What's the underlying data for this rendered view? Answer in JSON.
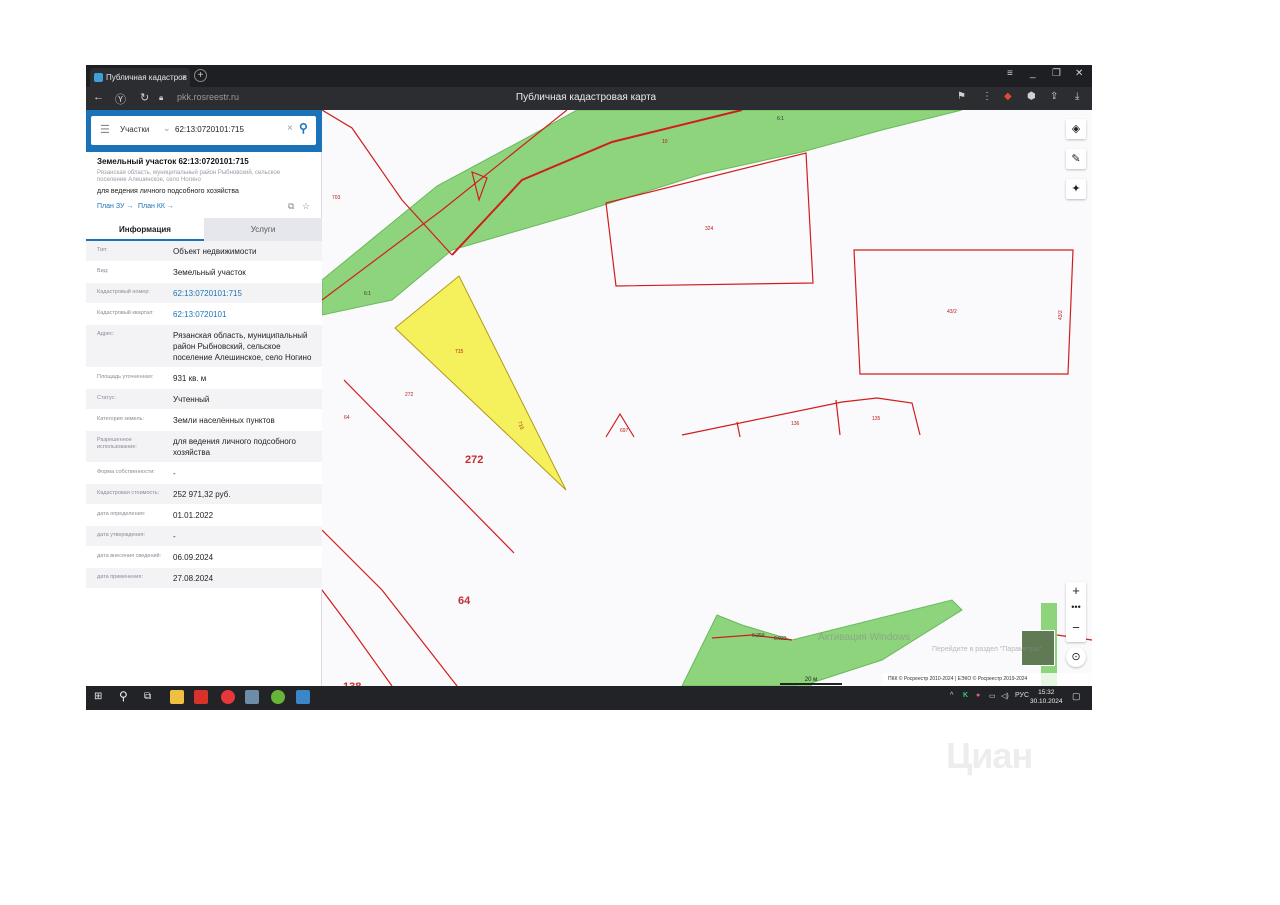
{
  "browser": {
    "tab_title": "Публичная кадастров",
    "url": "pkk.rosreestr.ru",
    "page_title": "Публичная кадастровая карта"
  },
  "search": {
    "type_label": "Участки",
    "value": "62:13:0720101:715"
  },
  "parcel": {
    "title": "Земельный участок 62:13:0720101:715",
    "address_small": "Рязанская область, муниципальный район Рыбновский, сельское поселение Алешинское, село Ногино",
    "purpose": "для ведения личного подсобного хозяйства",
    "link_plan_zu": "План ЗУ →",
    "link_plan_kk": "План КК →"
  },
  "tabs": {
    "info": "Информация",
    "services": "Услуги"
  },
  "info_rows": [
    {
      "key": "Тип:",
      "value": "Объект недвижимости"
    },
    {
      "key": "Вид:",
      "value": "Земельный участок"
    },
    {
      "key": "Кадастровый номер:",
      "value": "62:13:0720101:715"
    },
    {
      "key": "Кадастровый квартал:",
      "value": "62:13:0720101"
    },
    {
      "key": "Адрес:",
      "value": "Рязанская область, муниципальный район Рыбновский, сельское поселение Алешинское, село Ногино"
    },
    {
      "key": "Площадь уточненная:",
      "value": "931 кв. м"
    },
    {
      "key": "Статус:",
      "value": "Учтенный"
    },
    {
      "key": "Категория земель:",
      "value": "Земли населённых пунктов"
    },
    {
      "key": "Разрешенное использование:",
      "value": "для ведения личного подсобного хозяйства"
    },
    {
      "key": "Форма собственности:",
      "value": "-"
    },
    {
      "key": "Кадастровая стоимость:",
      "value": "252 971,32 руб."
    },
    {
      "key": "дата определения:",
      "value": "01.01.2022"
    },
    {
      "key": "дата утверждения:",
      "value": "-"
    },
    {
      "key": "дата внесения сведений:",
      "value": "06.09.2024"
    },
    {
      "key": "дата применения:",
      "value": "27.08.2024"
    }
  ],
  "map_labels": {
    "l703": "703",
    "l61a": "6:1",
    "l61b": "6:1",
    "l10": "10",
    "l324": "324",
    "l432a": "43/2",
    "l432b": "43/2",
    "l715a": "715",
    "l715b": "715",
    "l272s": "272",
    "l272b": "272",
    "l64s": "64",
    "l64b": "64",
    "l697": "697",
    "l136": "136",
    "l135": "135",
    "l138": "138",
    "l6259": "6:259",
    "l6923": "6:923"
  },
  "map": {
    "scale": "20 м",
    "watermark1": "Активация Windows",
    "watermark2": "Перейдите в раздел \"Параметры\"",
    "copyright": "ПКК © Росреестр 2010-2024 | ЕЭКО © Росреестр 2019-2024"
  },
  "taskbar": {
    "lang": "РУС",
    "time": "15:32",
    "date": "30.10.2024"
  },
  "outer_watermark": "Циан",
  "colors": {
    "green_zone": "#8dd47c",
    "parcel_yellow": "#f4f15c",
    "boundary_red": "#d21d1d",
    "accent_blue": "#1a73b8"
  }
}
